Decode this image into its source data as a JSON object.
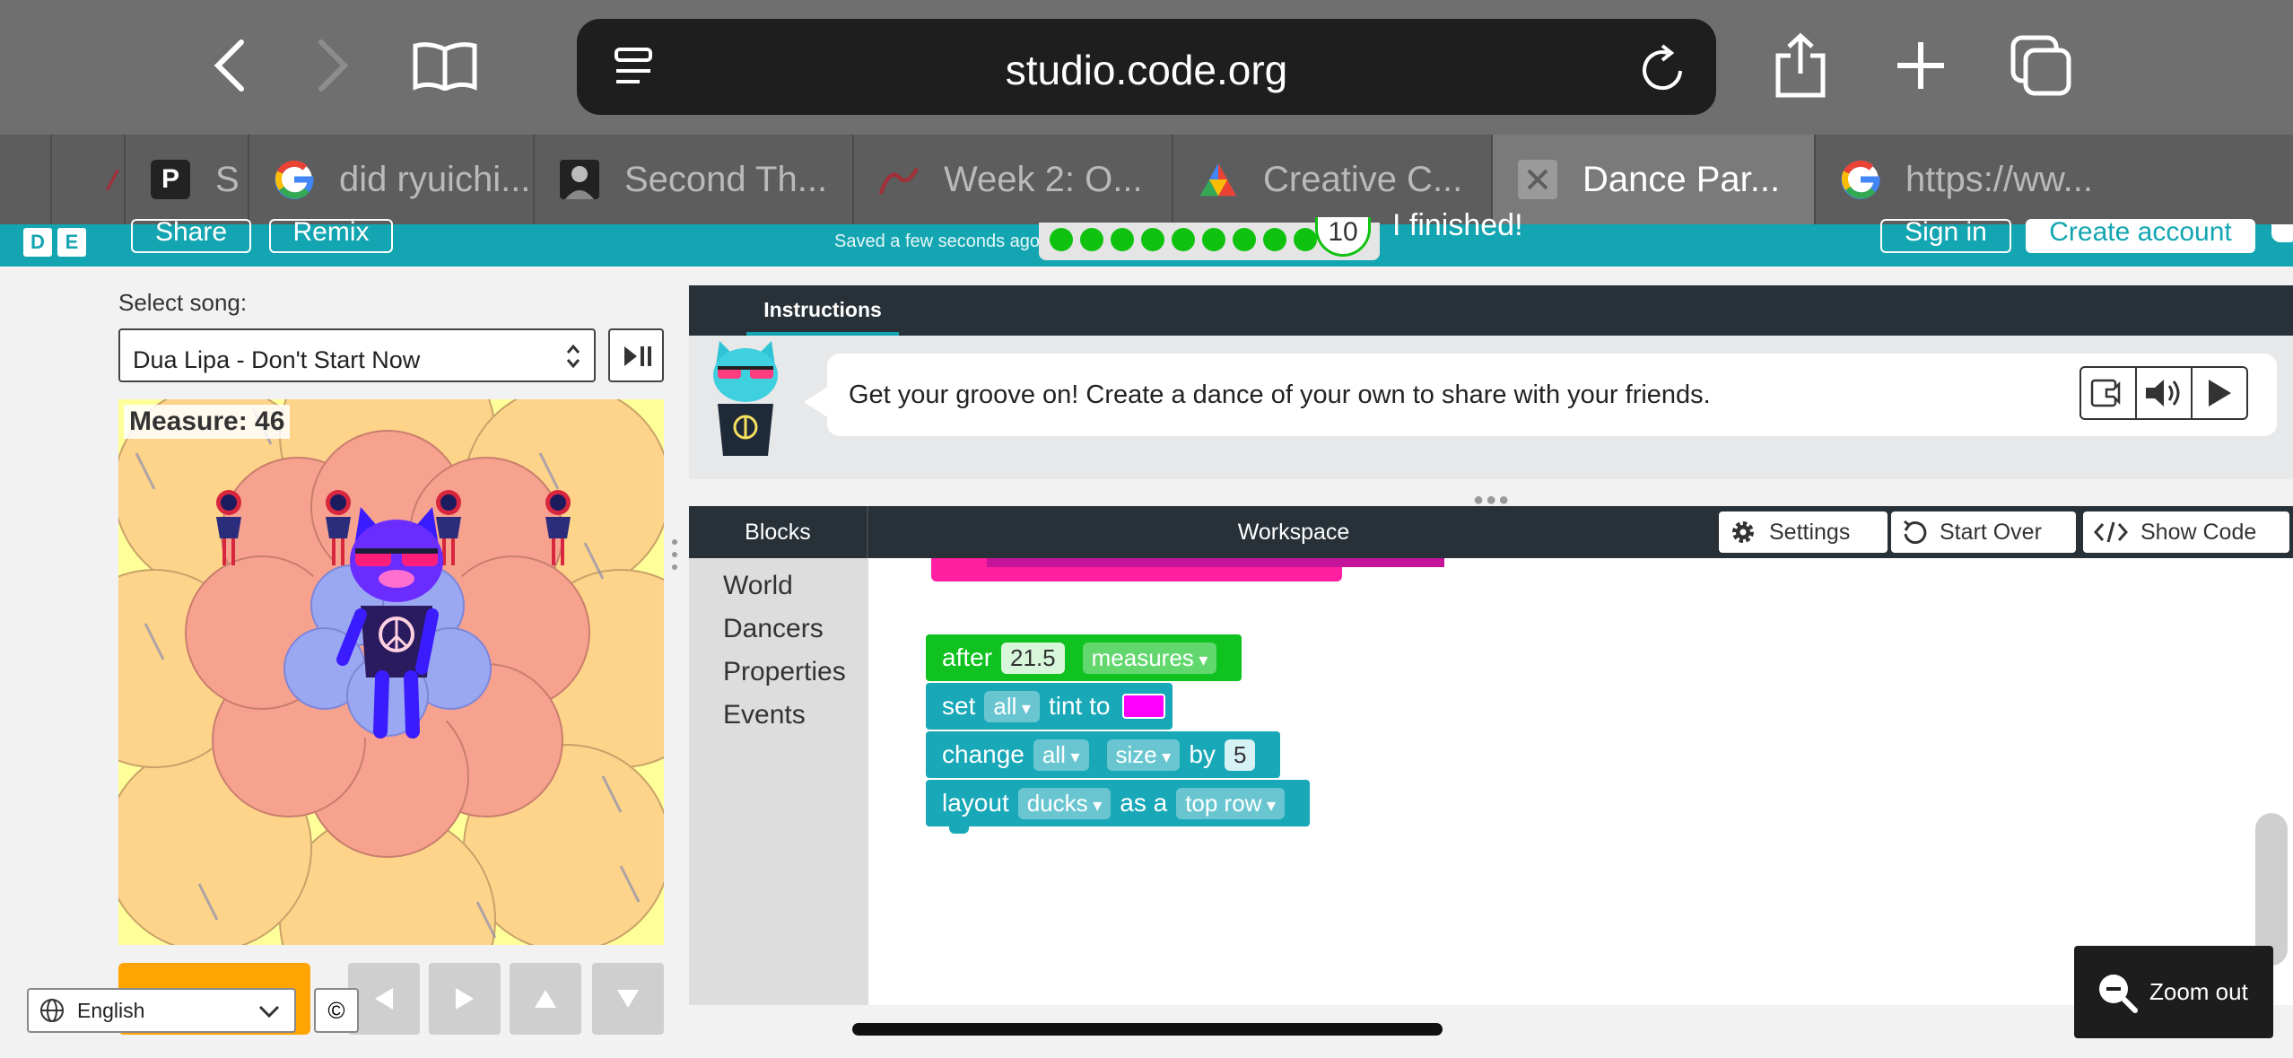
{
  "browser": {
    "url": "studio.code.org",
    "tabs": [
      {
        "label": "S",
        "icon": "p-icon"
      },
      {
        "label": "did ryuichi...",
        "icon": "google-icon"
      },
      {
        "label": "Second Th...",
        "icon": "portrait-icon"
      },
      {
        "label": "Week 2: O...",
        "icon": "swoosh-icon"
      },
      {
        "label": "Creative C...",
        "icon": "triangle-icon"
      },
      {
        "label": "Dance Par...",
        "icon": "close-icon",
        "active": true
      },
      {
        "label": "https://ww...",
        "icon": "google-icon"
      }
    ]
  },
  "header": {
    "share_label": "Share",
    "remix_label": "Remix",
    "saved_text": "Saved a few seconds ago",
    "progress_level": "10",
    "finished_text": "I finished!",
    "sign_in_label": "Sign in",
    "create_account_label": "Create account",
    "badge_d": "D",
    "badge_e": "E"
  },
  "song": {
    "label": "Select song:",
    "selected": "Dua Lipa - Don't Start Now"
  },
  "stage": {
    "measure": "Measure: 46"
  },
  "footer": {
    "language": "English",
    "copyright": "©"
  },
  "instructions": {
    "tab_label": "Instructions",
    "text": "Get your groove on! Create a dance of your own to share with your friends."
  },
  "workspace": {
    "blocks_label": "Blocks",
    "workspace_label": "Workspace",
    "settings_label": "Settings",
    "start_over_label": "Start Over",
    "show_code_label": "Show Code",
    "categories": [
      "World",
      "Dancers",
      "Properties",
      "Events"
    ],
    "code_blocks": {
      "after": {
        "word": "after",
        "value": "21.5",
        "unit": "measures"
      },
      "set": {
        "word": "set",
        "target": "all",
        "word2": "tint to",
        "color": "#ff00ff"
      },
      "change": {
        "word": "change",
        "target": "all",
        "property": "size",
        "word2": "by",
        "value": "5"
      },
      "layout": {
        "word": "layout",
        "target": "ducks",
        "word2": "as a",
        "arrangement": "top row"
      }
    },
    "zoom_label": "Zoom out"
  },
  "colors": {
    "header_teal": "#13a5b1",
    "event_green": "#0fc21f",
    "action_teal": "#19a8b8",
    "run_orange": "#ffa400",
    "dark_panel": "#283137"
  }
}
